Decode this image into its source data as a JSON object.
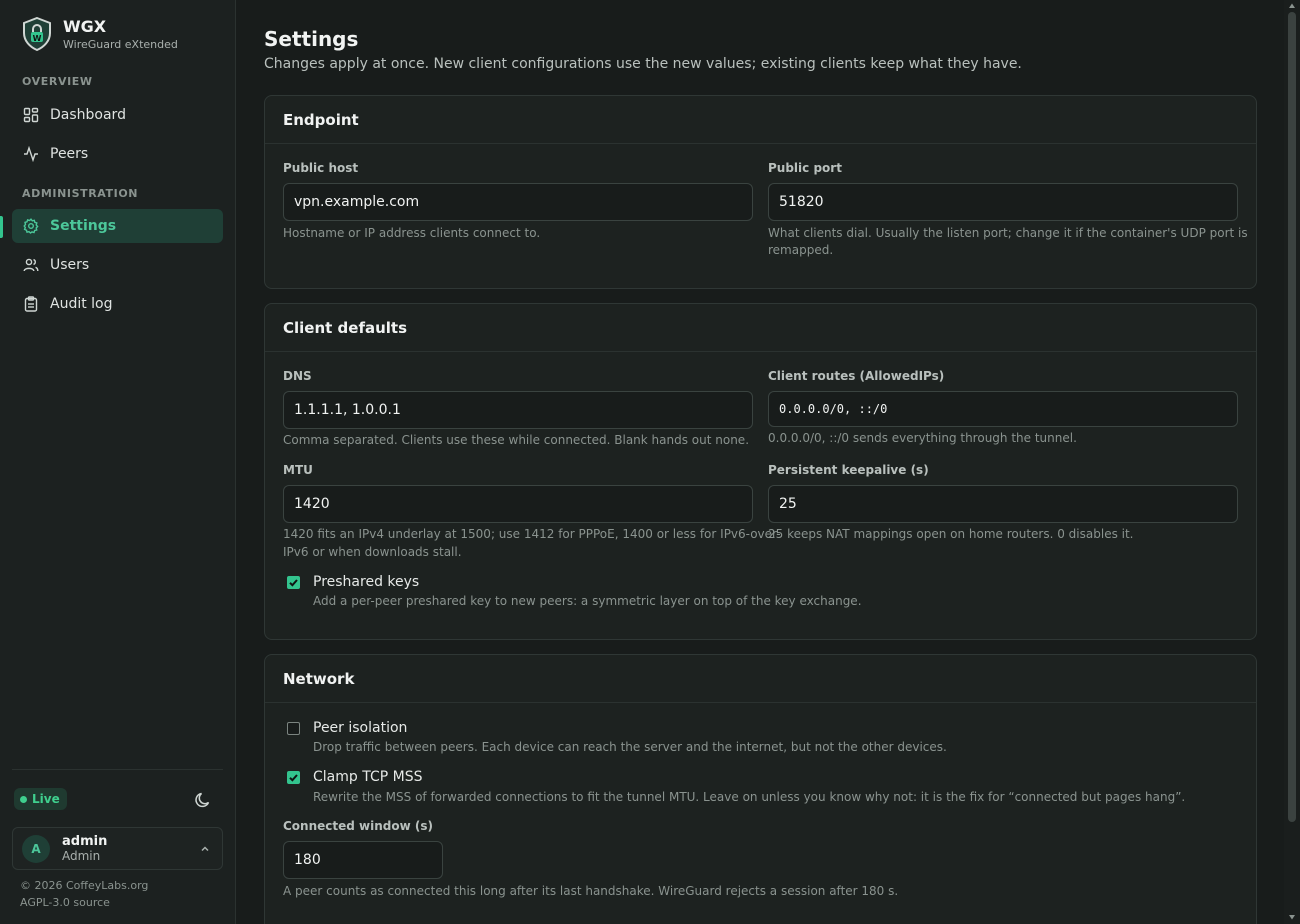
{
  "brand": {
    "name": "WGX",
    "subtitle": "WireGuard eXtended"
  },
  "sidebar": {
    "overview_label": "OVERVIEW",
    "admin_label": "ADMINISTRATION",
    "items": [
      {
        "label": "Dashboard",
        "icon": "dashboard-icon"
      },
      {
        "label": "Peers",
        "icon": "activity-icon"
      },
      {
        "label": "Settings",
        "icon": "gear-icon",
        "active": true
      },
      {
        "label": "Users",
        "icon": "users-icon"
      },
      {
        "label": "Audit log",
        "icon": "clipboard-icon"
      }
    ],
    "status": "Live",
    "user": {
      "initial": "A",
      "name": "admin",
      "role": "Admin"
    },
    "footer_copyright": "© 2026 CoffeyLabs.org",
    "footer_source": "AGPL-3.0 source"
  },
  "page": {
    "title": "Settings",
    "subtitle": "Changes apply at once. New client configurations use the new values; existing clients keep what they have."
  },
  "endpoint": {
    "title": "Endpoint",
    "public_host_label": "Public host",
    "public_host_value": "vpn.example.com",
    "public_host_hint": "Hostname or IP address clients connect to.",
    "public_port_label": "Public port",
    "public_port_value": "51820",
    "public_port_hint_1": "What clients dial. Usually the listen port; change it if the container's UDP port is",
    "public_port_hint_2": "remapped."
  },
  "client_defaults": {
    "title": "Client defaults",
    "dns_label": "DNS",
    "dns_value": "1.1.1.1, 1.0.0.1",
    "dns_hint": "Comma separated. Clients use these while connected. Blank hands out none.",
    "routes_label": "Client routes (AllowedIPs)",
    "routes_value": "0.0.0.0/0, ::/0",
    "routes_hint": "0.0.0.0/0, ::/0 sends everything through the tunnel.",
    "mtu_label": "MTU",
    "mtu_value": "1420",
    "mtu_hint_1": "1420 fits an IPv4 underlay at 1500; use 1412 for PPPoE, 1400 or less for IPv6-over-",
    "mtu_hint_2": "IPv6 or when downloads stall.",
    "keepalive_label": "Persistent keepalive (s)",
    "keepalive_value": "25",
    "keepalive_hint": "25 keeps NAT mappings open on home routers. 0 disables it.",
    "psk_label": "Preshared keys",
    "psk_checked": true,
    "psk_hint": "Add a per-peer preshared key to new peers: a symmetric layer on top of the key exchange."
  },
  "network": {
    "title": "Network",
    "isolation_label": "Peer isolation",
    "isolation_checked": false,
    "isolation_hint": "Drop traffic between peers. Each device can reach the server and the internet, but not the other devices.",
    "mss_label": "Clamp TCP MSS",
    "mss_checked": true,
    "mss_hint": "Rewrite the MSS of forwarded connections to fit the tunnel MTU. Leave on unless you know why not: it is the fix for “connected but pages hang”.",
    "window_label": "Connected window (s)",
    "window_value": "180",
    "window_hint": "A peer counts as connected this long after its last handshake. WireGuard rejects a session after 180 s."
  },
  "colors": {
    "accent": "#33c48e",
    "background": "#181c1b",
    "card": "#1d2220"
  }
}
